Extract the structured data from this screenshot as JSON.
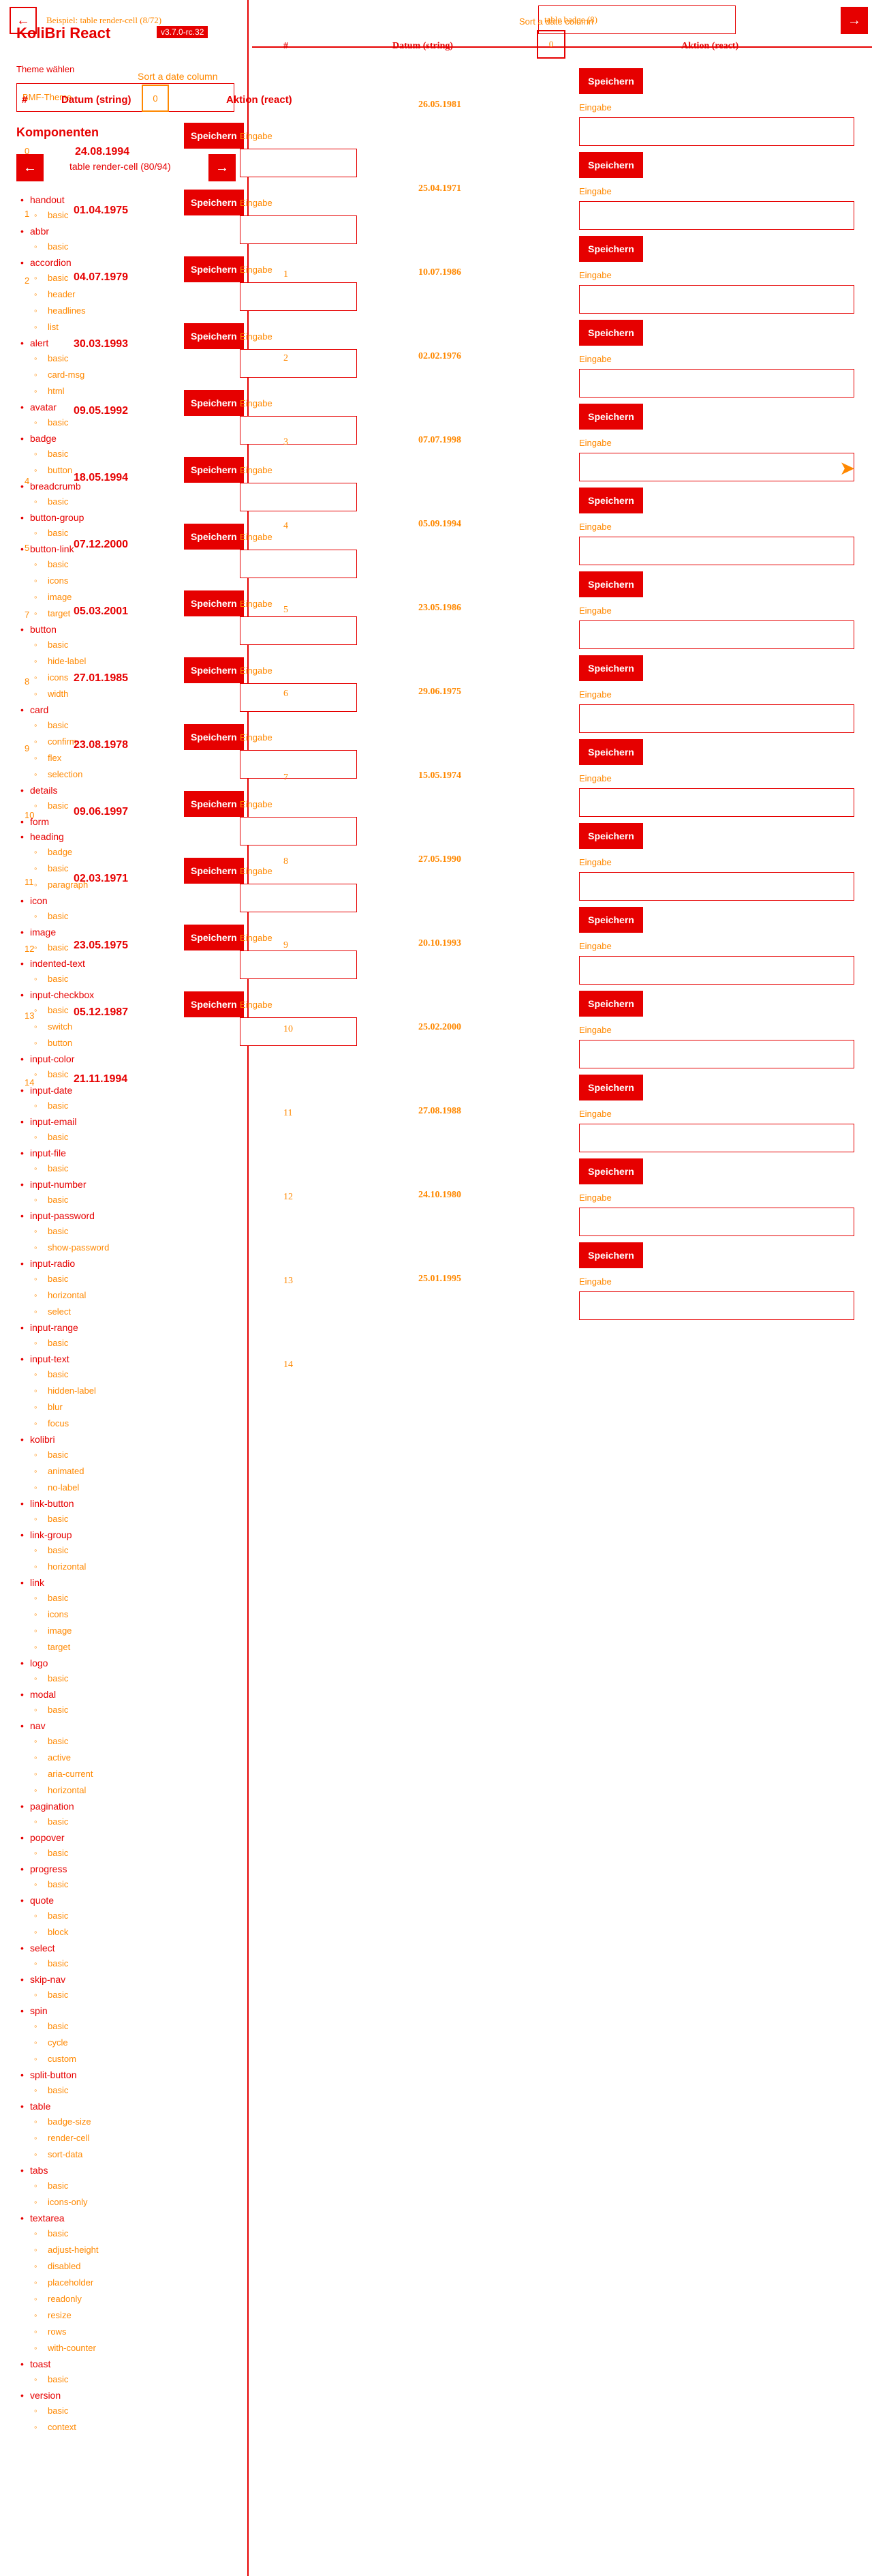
{
  "banner": {
    "example_title": "Beispiel: table render-cell (8/72)",
    "version": "v3.7.0-rc.32",
    "theme_button": "BMF-Theme",
    "next_example": "table badge (8)"
  },
  "sidebar": {
    "app_title": "KoliBri React",
    "theme_label": "Theme wählen",
    "theme_value": "BMF-Theme",
    "section_title": "Komponenten",
    "components": [
      {
        "name": "handout",
        "variants": [
          "basic"
        ]
      },
      {
        "name": "abbr",
        "variants": [
          "basic"
        ]
      },
      {
        "name": "accordion",
        "variants": [
          "basic",
          "header",
          "headlines",
          "list"
        ]
      },
      {
        "name": "alert",
        "variants": [
          "basic",
          "card-msg",
          "html"
        ]
      },
      {
        "name": "avatar",
        "variants": [
          "basic"
        ]
      },
      {
        "name": "badge",
        "variants": [
          "basic",
          "button"
        ]
      },
      {
        "name": "breadcrumb",
        "variants": [
          "basic"
        ]
      },
      {
        "name": "button-group",
        "variants": [
          "basic"
        ]
      },
      {
        "name": "button-link",
        "variants": [
          "basic",
          "icons",
          "image",
          "target"
        ]
      },
      {
        "name": "button",
        "variants": [
          "basic",
          "hide-label",
          "icons",
          "width"
        ]
      },
      {
        "name": "card",
        "variants": [
          "basic",
          "confirm",
          "flex",
          "selection"
        ]
      },
      {
        "name": "details",
        "variants": [
          "basic"
        ]
      },
      {
        "name": "form",
        "variants": []
      },
      {
        "name": "heading",
        "variants": [
          "badge",
          "basic",
          "paragraph"
        ]
      },
      {
        "name": "icon",
        "variants": [
          "basic"
        ]
      },
      {
        "name": "image",
        "variants": [
          "basic"
        ]
      },
      {
        "name": "indented-text",
        "variants": [
          "basic"
        ]
      },
      {
        "name": "input-checkbox",
        "variants": [
          "basic",
          "switch",
          "button"
        ]
      },
      {
        "name": "input-color",
        "variants": [
          "basic"
        ]
      },
      {
        "name": "input-date",
        "variants": [
          "basic"
        ]
      },
      {
        "name": "input-email",
        "variants": [
          "basic"
        ]
      },
      {
        "name": "input-file",
        "variants": [
          "basic"
        ]
      },
      {
        "name": "input-number",
        "variants": [
          "basic"
        ]
      },
      {
        "name": "input-password",
        "variants": [
          "basic",
          "show-password"
        ]
      },
      {
        "name": "input-radio",
        "variants": [
          "basic",
          "horizontal",
          "select"
        ]
      },
      {
        "name": "input-range",
        "variants": [
          "basic"
        ]
      },
      {
        "name": "input-text",
        "variants": [
          "basic",
          "hidden-label",
          "blur",
          "focus"
        ]
      },
      {
        "name": "kolibri",
        "variants": [
          "basic",
          "animated",
          "no-label"
        ]
      },
      {
        "name": "link-button",
        "variants": [
          "basic"
        ]
      },
      {
        "name": "link-group",
        "variants": [
          "basic",
          "horizontal"
        ]
      },
      {
        "name": "link",
        "variants": [
          "basic",
          "icons",
          "image",
          "target"
        ]
      },
      {
        "name": "logo",
        "variants": [
          "basic"
        ]
      },
      {
        "name": "modal",
        "variants": [
          "basic"
        ]
      },
      {
        "name": "nav",
        "variants": [
          "basic",
          "active",
          "aria-current",
          "horizontal"
        ]
      },
      {
        "name": "pagination",
        "variants": [
          "basic"
        ]
      },
      {
        "name": "popover",
        "variants": [
          "basic"
        ]
      },
      {
        "name": "progress",
        "variants": [
          "basic"
        ]
      },
      {
        "name": "quote",
        "variants": [
          "basic",
          "block"
        ]
      },
      {
        "name": "select",
        "variants": [
          "basic"
        ]
      },
      {
        "name": "skip-nav",
        "variants": [
          "basic"
        ]
      },
      {
        "name": "spin",
        "variants": [
          "basic",
          "cycle",
          "custom"
        ]
      },
      {
        "name": "split-button",
        "variants": [
          "basic"
        ]
      },
      {
        "name": "table",
        "variants": [
          "badge-size",
          "render-cell",
          "sort-data"
        ]
      },
      {
        "name": "tabs",
        "variants": [
          "basic",
          "icons-only"
        ]
      },
      {
        "name": "textarea",
        "variants": [
          "basic",
          "adjust-height",
          "disabled",
          "placeholder",
          "readonly",
          "resize",
          "rows",
          "with-counter"
        ]
      },
      {
        "name": "toast",
        "variants": [
          "basic"
        ]
      },
      {
        "name": "version",
        "variants": [
          "basic",
          "context"
        ]
      }
    ]
  },
  "overlay": {
    "sort_caption": "Sort a date column",
    "sort_button": "0",
    "header_num": "#",
    "header_date": "Datum (string)",
    "header_action": "Aktion (react)",
    "example_counter": "0",
    "example_date": "24.08.1994",
    "example_caption": "table render-cell (80/94)",
    "save_label": "Speichern",
    "input_label": "Eingabe",
    "rows": [
      {
        "num": "1",
        "date": "01.04.1975"
      },
      {
        "num": "2",
        "date": "04.07.1979"
      },
      {
        "num": "",
        "date": "30.03.1993"
      },
      {
        "num": "",
        "date": "09.05.1992"
      },
      {
        "num": "4",
        "date": "18.05.1994"
      },
      {
        "num": "5",
        "date": "07.12.2000"
      },
      {
        "num": "7",
        "date": "05.03.2001"
      },
      {
        "num": "8",
        "date": "27.01.1985"
      },
      {
        "num": "9",
        "date": "23.08.1978"
      },
      {
        "num": "10",
        "date": "09.06.1997"
      },
      {
        "num": "11",
        "date": "02.03.1971"
      },
      {
        "num": "12",
        "date": "23.05.1975"
      },
      {
        "num": "13",
        "date": "05.12.1987"
      },
      {
        "num": "14",
        "date": "21.11.1994"
      }
    ]
  },
  "main": {
    "sort_caption": "Sort a date column",
    "sort_button": "0",
    "header_num": "#",
    "header_date": "Datum (string)",
    "header_action": "Aktion (react)",
    "save_label": "Speichern",
    "input_label": "Eingabe",
    "rows": [
      {
        "num": "",
        "date": "26.05.1981"
      },
      {
        "num": "1",
        "date": "25.04.1971"
      },
      {
        "num": "2",
        "date": "10.07.1986"
      },
      {
        "num": "3",
        "date": "02.02.1976"
      },
      {
        "num": "4",
        "date": "07.07.1998"
      },
      {
        "num": "5",
        "date": "05.09.1994"
      },
      {
        "num": "6",
        "date": "23.05.1986"
      },
      {
        "num": "7",
        "date": "29.06.1975"
      },
      {
        "num": "8",
        "date": "15.05.1974"
      },
      {
        "num": "9",
        "date": "27.05.1990"
      },
      {
        "num": "10",
        "date": "20.10.1993"
      },
      {
        "num": "11",
        "date": "25.02.2000"
      },
      {
        "num": "12",
        "date": "27.08.1988"
      },
      {
        "num": "13",
        "date": "24.10.1980"
      },
      {
        "num": "14",
        "date": "25.01.1995"
      }
    ]
  }
}
